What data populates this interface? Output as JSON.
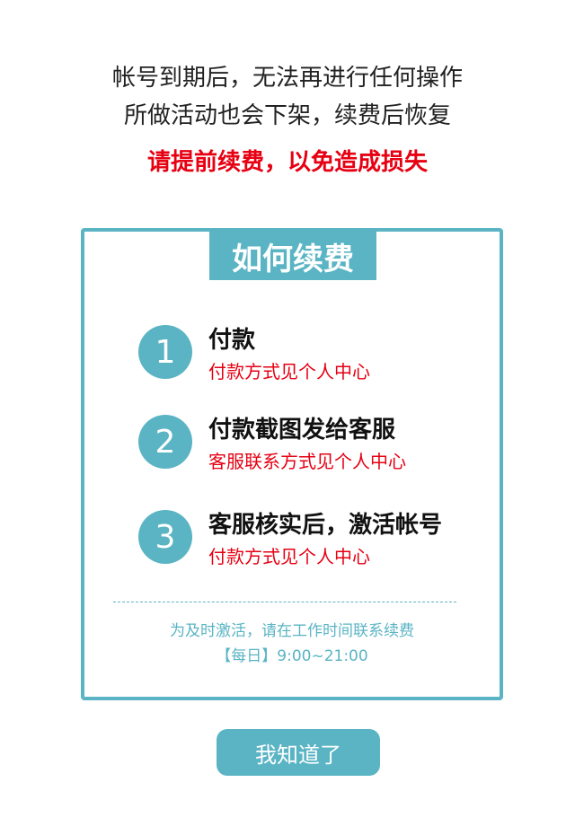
{
  "intro": {
    "line1": "帐号到期后，无法再进行任何操作",
    "line2": "所做活动也会下架，续费后恢复",
    "warning": "请提前续费，以免造成损失"
  },
  "card": {
    "title": "如何续费",
    "steps": [
      {
        "number": "1",
        "title": "付款",
        "subtitle": "付款方式见个人中心"
      },
      {
        "number": "2",
        "title": "付款截图发给客服",
        "subtitle": "客服联系方式见个人中心"
      },
      {
        "number": "3",
        "title": "客服核实后，激活帐号",
        "subtitle": "付款方式见个人中心"
      }
    ],
    "note_line1": "为及时激活，请在工作时间联系续费",
    "note_line2": "【每日】9:00~21:00"
  },
  "button": {
    "label": "我知道了"
  },
  "colors": {
    "accent": "#5ab4c4",
    "warning": "#e60012",
    "text": "#222222"
  }
}
